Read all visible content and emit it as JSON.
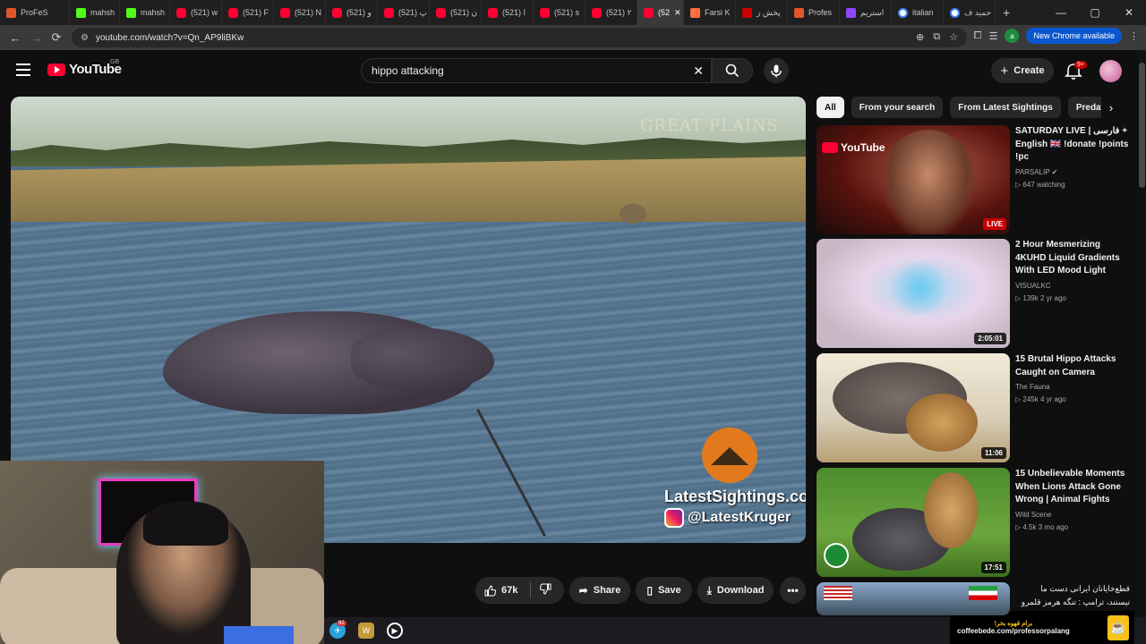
{
  "browser": {
    "tabs": [
      {
        "label": "ProFeS",
        "icon": "avatar-icon",
        "active": false
      },
      {
        "label": "mahsh",
        "icon": "kick-icon",
        "active": false
      },
      {
        "label": "mahsh",
        "icon": "kick-icon",
        "active": false
      },
      {
        "label": "(521) w",
        "icon": "youtube-icon",
        "active": false
      },
      {
        "label": "(521) F",
        "icon": "youtube-icon",
        "active": false
      },
      {
        "label": "(521) N",
        "icon": "youtube-icon",
        "active": false
      },
      {
        "label": "(521) و",
        "icon": "youtube-icon",
        "active": false
      },
      {
        "label": "(521) پ",
        "icon": "youtube-icon",
        "active": false
      },
      {
        "label": "(521) ن",
        "icon": "youtube-icon",
        "active": false
      },
      {
        "label": "(521) ا",
        "icon": "youtube-icon",
        "active": false
      },
      {
        "label": "(521) s",
        "icon": "youtube-icon",
        "active": false
      },
      {
        "label": "(521) ۲",
        "icon": "youtube-icon",
        "active": false
      },
      {
        "label": "(52",
        "icon": "youtube-icon",
        "active": true
      },
      {
        "label": "Farsi K",
        "icon": "doc-icon",
        "active": false
      },
      {
        "label": "پخش ز",
        "icon": "tw-icon",
        "active": false
      },
      {
        "label": "Profes",
        "icon": "prof-icon",
        "active": false
      },
      {
        "label": "استریم",
        "icon": "twitch-icon",
        "active": false
      },
      {
        "label": "italian",
        "icon": "google-icon",
        "active": false
      },
      {
        "label": "حمید ف",
        "icon": "google-icon",
        "active": false
      }
    ],
    "url": "youtube.com/watch?v=Qn_AP9liBKw",
    "new_chrome": "New Chrome available",
    "profile_letter": "a"
  },
  "youtube": {
    "logo": "YouTube",
    "country": "GB",
    "search_query": "hippo attacking",
    "create_label": "Create",
    "notif_count": "9+"
  },
  "video": {
    "watermark_top": "GREAT PLAINS",
    "channel_watermark": "LatestSightings.com",
    "ig_handle": "@LatestKruger"
  },
  "actions": {
    "likes": "67k",
    "share": "Share",
    "save": "Save",
    "download": "Download"
  },
  "chips": [
    "All",
    "From your search",
    "From Latest Sightings",
    "Predatio"
  ],
  "recommendations": [
    {
      "title": "SATURDAY LIVE | فارسی + English 🇬🇧 !donate !points !pc",
      "channel": "PARSALIP",
      "verified": true,
      "meta1": "647 watching",
      "meta2": "",
      "badge": "LIVE",
      "thumb_text": "YouTube"
    },
    {
      "title": "2 Hour Mesmerizing 4KUHD Liquid Gradients With LED Mood Light",
      "channel": "VISUALKC",
      "verified": false,
      "meta1": "139k",
      "meta2": "2 yr ago",
      "badge": "2:05:01",
      "thumb_text": ""
    },
    {
      "title": "15 Brutal Hippo Attacks Caught on Camera",
      "channel": "The Fauna",
      "verified": false,
      "meta1": "245k",
      "meta2": "4 yr ago",
      "badge": "11:06",
      "thumb_text": ""
    },
    {
      "title": "15 Unbelievable Moments When Lions Attack Gone Wrong | Animal Fights",
      "channel": "Wild Scene",
      "verified": false,
      "meta1": "4.5k",
      "meta2": "3 mo ago",
      "badge": "17:51",
      "thumb_text": ""
    },
    {
      "title": "قطع‌خایانان ایرانی دست ما نیستند، ترامپ : تنگه هرمز قلمرو آمریکا",
      "channel": "",
      "verified": false,
      "meta1": "",
      "meta2": "",
      "badge": "",
      "thumb_text": ""
    }
  ],
  "coffee": {
    "fa": "برام قهوه بخر!",
    "url": "coffeebede.com/professorpalang"
  },
  "taskbar": {
    "badge": "92"
  },
  "colors": {
    "youtube_red": "#ff0033",
    "background": "#0f0f0f",
    "chip_bg": "#272727",
    "chrome_blue": "#0b57d0",
    "coffee_yellow": "#f6c21a"
  }
}
